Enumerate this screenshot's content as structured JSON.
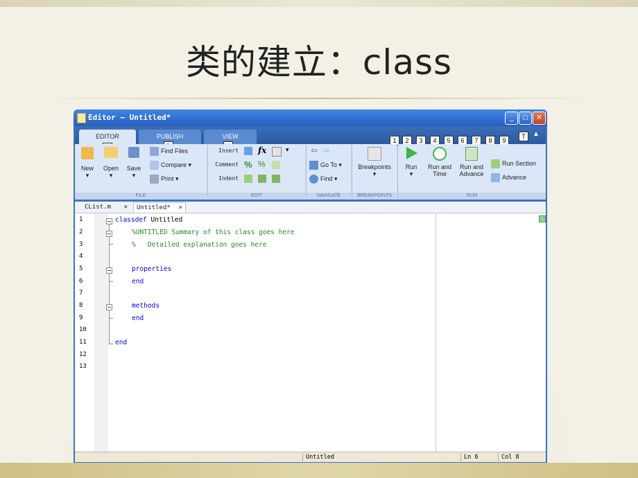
{
  "slide": {
    "title": "类的建立：class"
  },
  "window": {
    "title": "Editor – Untitled*"
  },
  "ribbon": {
    "tabs": [
      "EDITOR",
      "PUBLISH",
      "VIEW"
    ],
    "tab_shortcuts": [
      "E",
      "B",
      "W"
    ],
    "qat_shortcuts": [
      "1",
      "2",
      "3",
      "4",
      "5",
      "6",
      "7",
      "8",
      "9"
    ],
    "help_shortcut": "T",
    "file": {
      "new": "New",
      "open": "Open",
      "save": "Save",
      "find_files": "Find Files",
      "compare": "Compare",
      "print": "Print"
    },
    "edit": {
      "insert": "Insert",
      "comment": "Comment",
      "indent": "Indent",
      "fx": "fx"
    },
    "navigate": {
      "goto": "Go To",
      "find": "Find"
    },
    "breakpoints": {
      "label": "Breakpoints"
    },
    "run": {
      "run": "Run",
      "run_and_time_1": "Run and",
      "run_and_time_2": "Time",
      "run_and_advance_1": "Run and",
      "run_and_advance_2": "Advance",
      "run_section": "Run Section",
      "advance": "Advance"
    },
    "groups": [
      "FILE",
      "EDIT",
      "NAVIGATE",
      "BREAKPOINTS",
      "RUN"
    ]
  },
  "doc_tabs": [
    "CList.m",
    "Untitled*"
  ],
  "editor": {
    "line_numbers": [
      "1",
      "2",
      "3",
      "4",
      "5",
      "6",
      "7",
      "8",
      "9",
      "10",
      "11",
      "12",
      "13"
    ],
    "lines": [
      {
        "kw": "classdef",
        "text": " Untitled"
      },
      {
        "cm": "%UNTITLED Summary of this class goes here"
      },
      {
        "cm": "%   Detailed explanation goes here"
      },
      {},
      {
        "kw": "properties"
      },
      {
        "kw": "end"
      },
      {},
      {
        "kw": "methods"
      },
      {
        "kw": "end"
      },
      {},
      {
        "kw": "end"
      },
      {},
      {}
    ]
  },
  "status": {
    "file": "Untitled",
    "ln": "Ln  6",
    "col": "Col  8"
  }
}
